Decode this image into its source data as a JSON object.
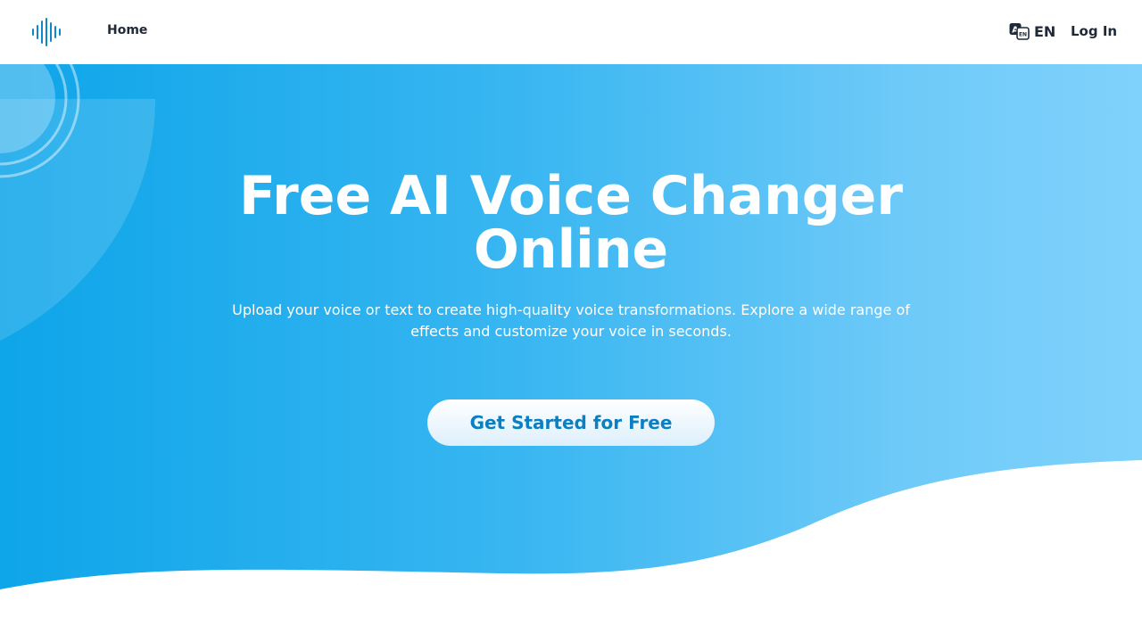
{
  "header": {
    "logo_icon": "waveform-logo-icon",
    "nav": {
      "home_label": "Home"
    },
    "language": {
      "icon": "translate-icon",
      "label": "EN"
    },
    "login_label": "Log In"
  },
  "hero": {
    "title": "Free AI Voice Changer Online",
    "subtitle": "Upload your voice or text to create high-quality voice transformations. Explore a wide range of effects and customize your voice in seconds.",
    "cta_label": "Get Started for Free"
  },
  "colors": {
    "brand_blue": "#0ea5e9",
    "gradient_end": "#7fd2fb",
    "cta_text": "#0a7fc2",
    "nav_text": "#1f2937"
  }
}
